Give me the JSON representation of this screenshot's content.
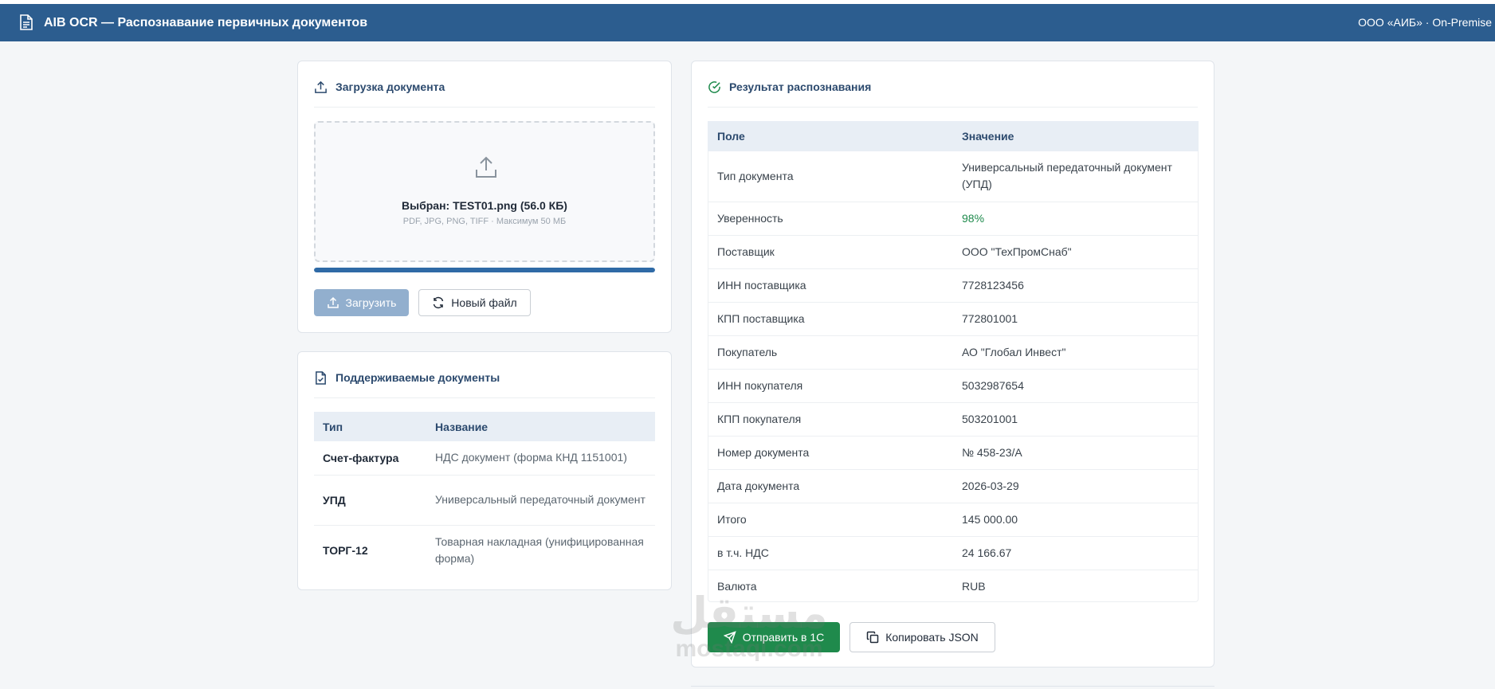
{
  "header": {
    "title": "AIB OCR — Распознавание первичных документов",
    "org": "ООО «АИБ» · On-Premise"
  },
  "upload": {
    "title": "Загрузка документа",
    "selected_file": "Выбран: TEST01.png (56.0 КБ)",
    "hint": "PDF, JPG, PNG, TIFF · Максимум 50 МБ",
    "progress_fraction": 1.0,
    "upload_button": "Загрузить",
    "new_file_button": "Новый файл"
  },
  "supported": {
    "title": "Поддерживаемые документы",
    "columns": [
      "Тип",
      "Название"
    ],
    "rows": [
      {
        "type": "Счет-фактура",
        "name": "НДС документ (форма КНД 1151001)"
      },
      {
        "type": "УПД",
        "name": "Универсальный передаточный документ"
      },
      {
        "type": "ТОРГ-12",
        "name": "Товарная накладная (унифицированная форма)"
      }
    ]
  },
  "result": {
    "title": "Результат распознавания",
    "columns": [
      "Поле",
      "Значение"
    ],
    "rows": [
      {
        "field": "Тип документа",
        "value": "Универсальный передаточный документ (УПД)"
      },
      {
        "field": "Уверенность",
        "value": "98%"
      },
      {
        "field": "Поставщик",
        "value": "ООО \"ТехПромСнаб\""
      },
      {
        "field": "ИНН поставщика",
        "value": "7728123456"
      },
      {
        "field": "КПП поставщика",
        "value": "772801001"
      },
      {
        "field": "Покупатель",
        "value": "АО \"Глобал Инвест\""
      },
      {
        "field": "ИНН покупателя",
        "value": "5032987654"
      },
      {
        "field": "КПП покупателя",
        "value": "503201001"
      },
      {
        "field": "Номер документа",
        "value": "№ 458-23/А"
      },
      {
        "field": "Дата документа",
        "value": "2026-03-29"
      },
      {
        "field": "Итого",
        "value": "145 000.00"
      },
      {
        "field": "в т.ч. НДС",
        "value": "24 166.67"
      },
      {
        "field": "Валюта",
        "value": "RUB"
      }
    ],
    "send_button": "Отправить в 1С",
    "copy_button": "Копировать JSON"
  },
  "watermark": {
    "arabic": "مستقل",
    "latin": "mostaql.com"
  },
  "colors": {
    "header_bg": "#2c5d8f",
    "accent": "#2f6aa6",
    "success": "#1f8a4c",
    "confidence_text": "#1e8a4c"
  }
}
